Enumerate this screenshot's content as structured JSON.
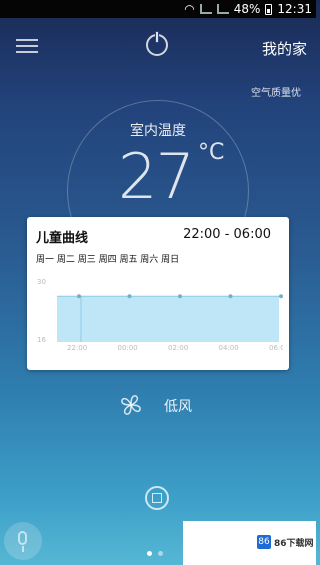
{
  "status_bar": {
    "battery": "48%",
    "time": "12:31"
  },
  "header": {
    "home_label": "我的家",
    "air_quality": "空气质量优"
  },
  "temperature": {
    "label": "室内温度",
    "value": "27",
    "unit": "°C"
  },
  "popup": {
    "title": "儿童曲线",
    "time_range": "22:00 - 06:00",
    "weekdays": "周一 周二 周三 周四 周五 周六 周日",
    "chart_data": {
      "type": "area",
      "x": [
        "22:00",
        "00:00",
        "02:00",
        "04:00",
        "06:00"
      ],
      "values": [
        26,
        26,
        26,
        26,
        26
      ],
      "ylim": [
        16,
        30
      ],
      "y_tick_labels": [
        "30",
        "16"
      ]
    },
    "colors": {
      "fill": "#bfe6f7",
      "line": "#8fcbe6"
    }
  },
  "fan": {
    "label": "低风",
    "icon": "fan-icon"
  },
  "watermark": {
    "logo": "86",
    "text": "86下载网"
  }
}
